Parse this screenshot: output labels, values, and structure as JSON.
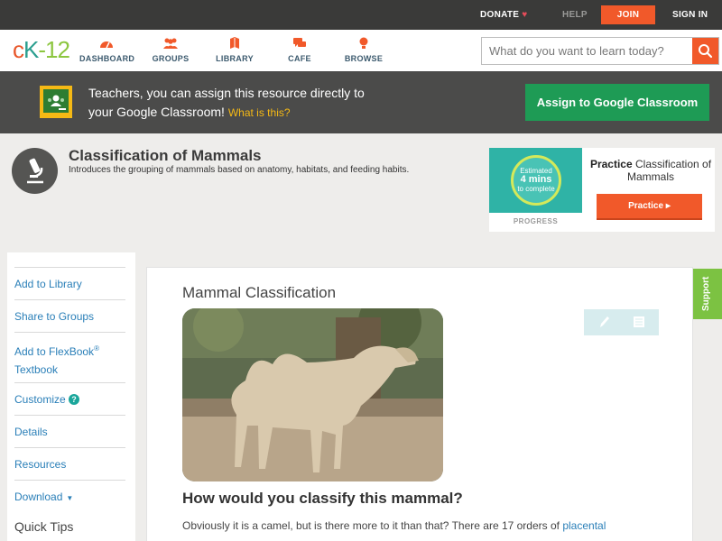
{
  "topbar": {
    "donate": "DONATE",
    "help": "HELP",
    "join": "JOIN",
    "signin": "SIGN IN"
  },
  "logo": {
    "c": "c",
    "k": "K",
    "n": "-12"
  },
  "nav": {
    "items": [
      {
        "label": "DASHBOARD",
        "icon": "dashboard-icon"
      },
      {
        "label": "GROUPS",
        "icon": "groups-icon"
      },
      {
        "label": "LIBRARY",
        "icon": "library-icon"
      },
      {
        "label": "CAFE",
        "icon": "cafe-icon"
      },
      {
        "label": "BROWSE",
        "icon": "browse-icon"
      }
    ]
  },
  "search": {
    "placeholder": "What do you want to learn today?",
    "value": ""
  },
  "banner": {
    "line1": "Teachers, you can assign this resource directly to",
    "line2": "your Google Classroom!",
    "what": "What is this?",
    "assign": "Assign to Google Classroom"
  },
  "topic": {
    "title": "Classification of Mammals",
    "description": "Introduces the grouping of mammals based on anatomy, habitats, and feeding habits."
  },
  "practice": {
    "estimated": "Estimated",
    "mins": "4 mins",
    "complete": "to complete",
    "progress": "PROGRESS",
    "title_bold": "Practice",
    "title_rest": " Classification of Mammals",
    "button": "Practice"
  },
  "sidebar": {
    "add_library": "Add to Library",
    "share": "Share to Groups",
    "flexbook_1": "Add to FlexBook",
    "flexbook_reg": "®",
    "flexbook_2": "Textbook",
    "customize": "Customize",
    "details": "Details",
    "resources": "Resources",
    "download": "Download",
    "quick_tips": "Quick Tips"
  },
  "content": {
    "title": "Mammal Classification",
    "question": "How would you classify this mammal?",
    "para_text": "Obviously it is a camel, but is there more to it than that? There are 17 orders of ",
    "para_link": "placental"
  },
  "support": "Support",
  "colors": {
    "accent": "#f1592a",
    "green": "#1e9b55",
    "link": "#2a7fb8",
    "teal": "#2fb3a6"
  }
}
